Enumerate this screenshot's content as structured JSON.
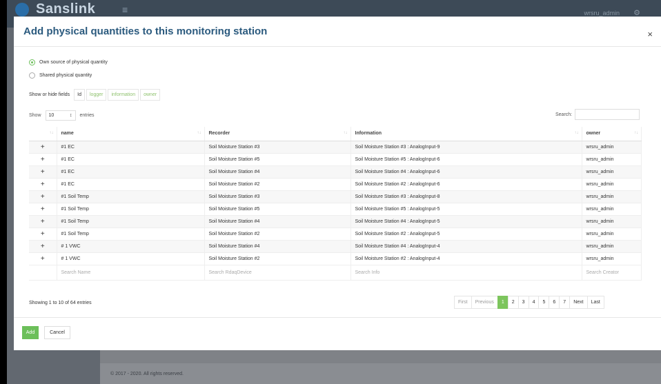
{
  "app": {
    "brand": "Sanslink",
    "menu_icon": "hamburger-icon",
    "user": "wrsru_admin"
  },
  "footer": {
    "copyright": "© 2017 - 2020. All rights reserved."
  },
  "modal": {
    "title": "Add physical quantities to this monitoring station",
    "close": "×",
    "source_options": [
      {
        "label": "Own source of physical quantity",
        "selected": true
      },
      {
        "label": "Shared physical quantity",
        "selected": false
      }
    ],
    "fields": {
      "label": "Show or hide fields",
      "buttons": [
        "Id",
        "logger",
        "information",
        "owner"
      ]
    },
    "length": {
      "show_label": "Show",
      "value": "10",
      "entries_label": "entries"
    },
    "search": {
      "label": "Search:"
    },
    "columns": [
      "",
      "name",
      "Recorder",
      "Information",
      "owner"
    ],
    "rows": [
      [
        "#1 EC",
        "Soil Moisture Station #3",
        "Soil Moisture Station #3 : AnalogInput-9",
        "wrsru_admin"
      ],
      [
        "#1 EC",
        "Soil Moisture Station #5",
        "Soil Moisture Station #5 : AnalogInput-6",
        "wrsru_admin"
      ],
      [
        "#1 EC",
        "Soil Moisture Station #4",
        "Soil Moisture Station #4 : AnalogInput-6",
        "wrsru_admin"
      ],
      [
        "#1 EC",
        "Soil Moisture Station #2",
        "Soil Moisture Station #2 : AnalogInput-6",
        "wrsru_admin"
      ],
      [
        "#1 Soil Temp",
        "Soil Moisture Station #3",
        "Soil Moisture Station #3 : AnalogInput-8",
        "wrsru_admin"
      ],
      [
        "#1 Soil Temp",
        "Soil Moisture Station #5",
        "Soil Moisture Station #5 : AnalogInput-5",
        "wrsru_admin"
      ],
      [
        "#1 Soil Temp",
        "Soil Moisture Station #4",
        "Soil Moisture Station #4 : AnalogInput-5",
        "wrsru_admin"
      ],
      [
        "#1 Soil Temp",
        "Soil Moisture Station #2",
        "Soil Moisture Station #2 : AnalogInput-5",
        "wrsru_admin"
      ],
      [
        "# 1 VWC",
        "Soil Moisture Station #4",
        "Soil Moisture Station #4 : AnalogInput-4",
        "wrsru_admin"
      ],
      [
        "# 1 VWC",
        "Soil Moisture Station #2",
        "Soil Moisture Station #2 : AnalogInput-4",
        "wrsru_admin"
      ]
    ],
    "row_action": "+",
    "filters": [
      "Search Name",
      "Search RdaqDevice",
      "Search Info",
      "Search Creator"
    ],
    "info": "Showing 1 to 10 of 64 entries",
    "pagination": {
      "items": [
        "First",
        "Previous",
        "1",
        "2",
        "3",
        "4",
        "5",
        "6",
        "7",
        "Next",
        "Last"
      ],
      "active": "1"
    },
    "buttons": {
      "add": "Add",
      "cancel": "Cancel"
    }
  }
}
